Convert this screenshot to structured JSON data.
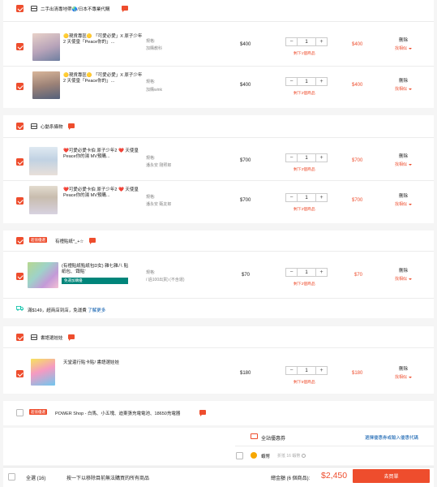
{
  "shops": [
    {
      "name": "二手出清專地帶🌏/日本不專業代購",
      "items": [
        {
          "title": "🟡現貨專區🟡 「可愛必愛」X 原子少年2 天使皇「Peace你的」...",
          "variation_label": "規格:",
          "variation_value": "加購教科",
          "price": "$400",
          "quantity": "1",
          "stock_note": "剩下1個商品",
          "subtotal": "$400",
          "delete_label": "刪除",
          "similar_label": "找相似"
        },
        {
          "title": "🟡現貨專區🟡 「可愛必愛」X 原子少年2 天使皇「Peace你的」...",
          "variation_label": "規格:",
          "variation_value": "加購wink",
          "price": "$400",
          "quantity": "1",
          "stock_note": "剩下2個商品",
          "subtotal": "$400",
          "delete_label": "刪除",
          "similar_label": "找相似"
        }
      ]
    },
    {
      "name": "心動系攝物",
      "items": [
        {
          "title": "❤️可愛必愛卡伯 原子少年2 ❤️ 天使皇 Peace你的湯 MV預購...",
          "variation_label": "規格:",
          "variation_value": "潘永安 剛照郎",
          "price": "$700",
          "quantity": "1",
          "stock_note": "剩下2個商品",
          "subtotal": "$700",
          "delete_label": "刪除",
          "similar_label": "找相似"
        },
        {
          "title": "❤️可愛必愛卡伯 原子少年2 ❤️ 天使皇 Peace你的湯 MV預購...",
          "variation_label": "規格:",
          "variation_value": "潘永安 甄友郎",
          "price": "$700",
          "quantity": "1",
          "stock_note": "剩下2個商品",
          "subtotal": "$700",
          "delete_label": "刪除",
          "similar_label": "找相似"
        }
      ]
    },
    {
      "name": "有禮貼紙*_+☆",
      "tag": "超值優選",
      "items": [
        {
          "title": "(有禮貼紙點紙包D女) 雜七雜八 貼紙包、'蹲貼'",
          "badge": "免運加購優",
          "variation_label": "規格:",
          "variation_value": "/ 過100出貨) (不含運)",
          "price": "$70",
          "quantity": "1",
          "stock_note": "剩下2個商品",
          "subtotal": "$70",
          "delete_label": "刪除",
          "similar_label": "找相似"
        }
      ]
    },
    {
      "name": "書語選娃娃",
      "items": [
        {
          "title": "天堂還行貼卡貼/ 書語選娃娃",
          "variation_label": "",
          "variation_value": "",
          "price": "$180",
          "quantity": "1",
          "stock_note": "剩下5個商品",
          "subtotal": "$180",
          "delete_label": "刪除",
          "similar_label": "找相似"
        }
      ]
    },
    {
      "name": "POWER Shop - 白馬、小五塊、迪東張充電電池、18650充電器",
      "tag": "超值優選",
      "items": []
    }
  ],
  "shipping_promo": {
    "text": "滿$149，超商店到店，免運費",
    "link": "了解更多"
  },
  "platform_voucher": {
    "label": "全站優惠券",
    "link": "選擇優惠券或輸入優惠代碼"
  },
  "coins": {
    "label": "蝦幣",
    "note": "折抵 16 蝦幣"
  },
  "footer": {
    "select_all": "全選 (16)",
    "remove_hint": "按一下以移除目前無法購買的所有商品",
    "total_label": "總金額 (6 個商品):",
    "total_value": "$2,450",
    "checkout": "去買單"
  },
  "colors": {
    "brand": "#ee4d2d",
    "badge_green": "#00857a",
    "link": "#0055aa"
  }
}
